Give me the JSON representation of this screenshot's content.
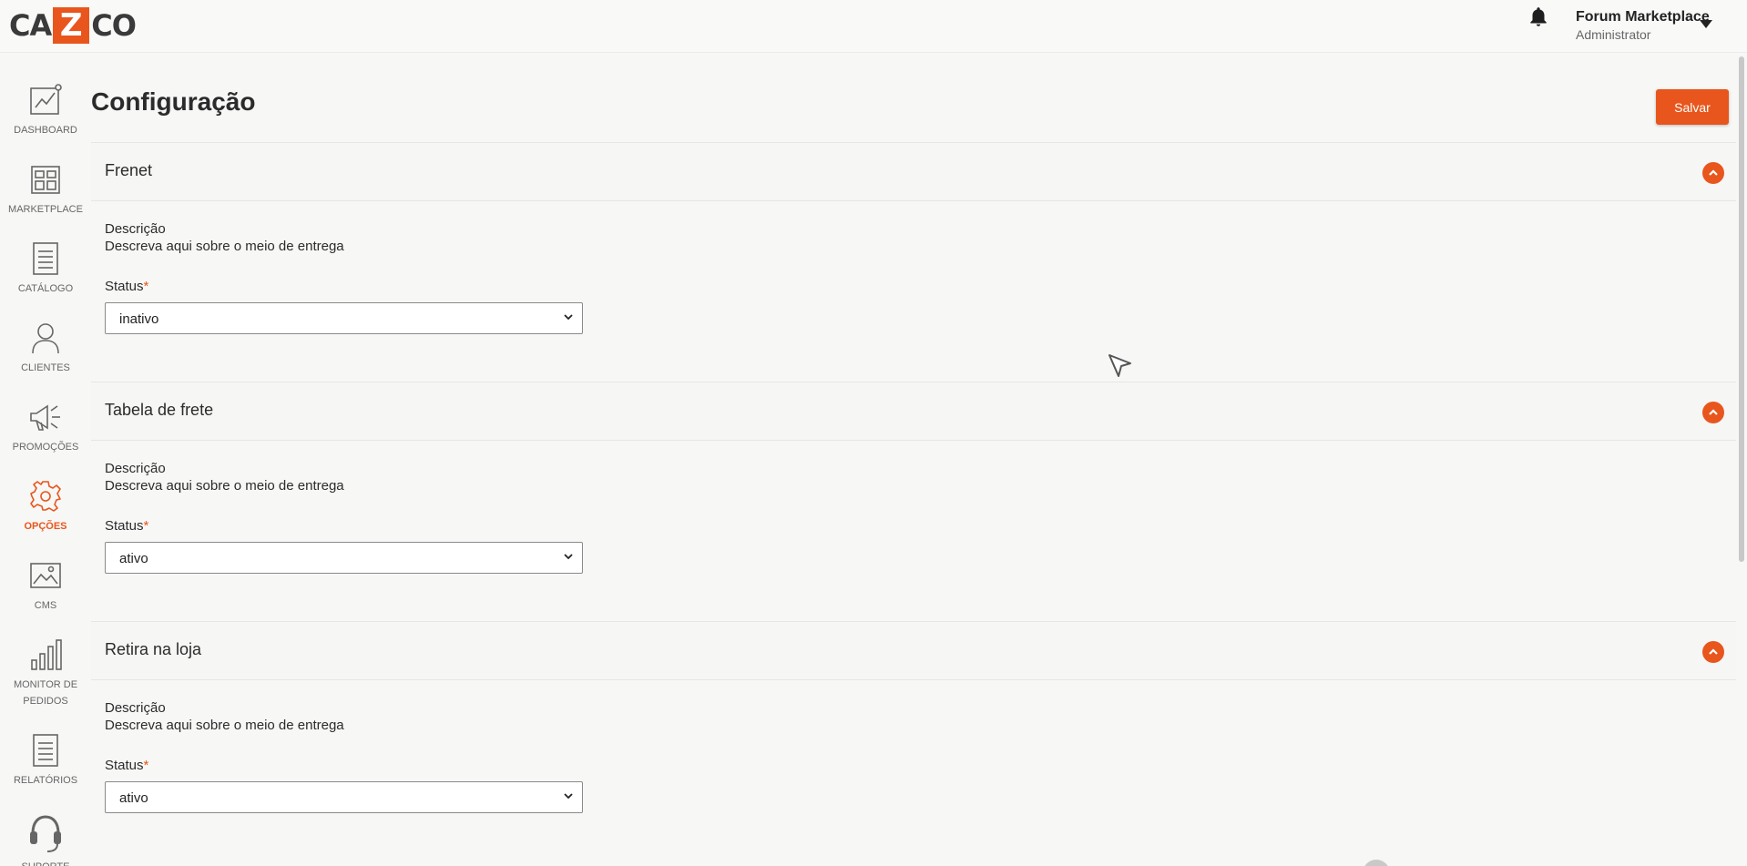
{
  "header": {
    "logo_left": "CA",
    "logo_z": "Z",
    "logo_right": "CO",
    "user_name": "Forum Marketplace",
    "user_role": "Administrator"
  },
  "sidebar": {
    "items": [
      {
        "label": "DASHBOARD",
        "icon": "chart-icon"
      },
      {
        "label": "MARKETPLACE",
        "icon": "storefront-icon"
      },
      {
        "label": "CATÁLOGO",
        "icon": "catalog-icon"
      },
      {
        "label": "CLIENTES",
        "icon": "person-icon"
      },
      {
        "label": "PROMOÇÕES",
        "icon": "megaphone-icon"
      },
      {
        "label": "OPÇÕES",
        "icon": "gear-icon",
        "active": true
      },
      {
        "label": "CMS",
        "icon": "image-icon"
      },
      {
        "label": "MONITOR DE PEDIDOS",
        "icon": "bar-chart-icon"
      },
      {
        "label": "RELATÓRIOS",
        "icon": "report-icon"
      },
      {
        "label": "SUPORTE",
        "icon": "headset-icon"
      }
    ]
  },
  "main": {
    "title": "Configuração",
    "save_label": "Salvar",
    "sections": [
      {
        "title": "Frenet",
        "desc_label": "Descrição",
        "desc_text": "Descreva aqui sobre o meio de entrega",
        "status_label": "Status",
        "status_required": "*",
        "status_value": "inativo"
      },
      {
        "title": "Tabela de frete",
        "desc_label": "Descrição",
        "desc_text": "Descreva aqui sobre o meio de entrega",
        "status_label": "Status",
        "status_required": "*",
        "status_value": "ativo"
      },
      {
        "title": "Retira na loja",
        "desc_label": "Descrição",
        "desc_text": "Descreva aqui sobre o meio de entrega",
        "status_label": "Status",
        "status_required": "*",
        "status_value": "ativo"
      }
    ]
  },
  "colors": {
    "accent": "#e8561d",
    "text": "#2b2b2b",
    "background": "#f7f7f6"
  }
}
